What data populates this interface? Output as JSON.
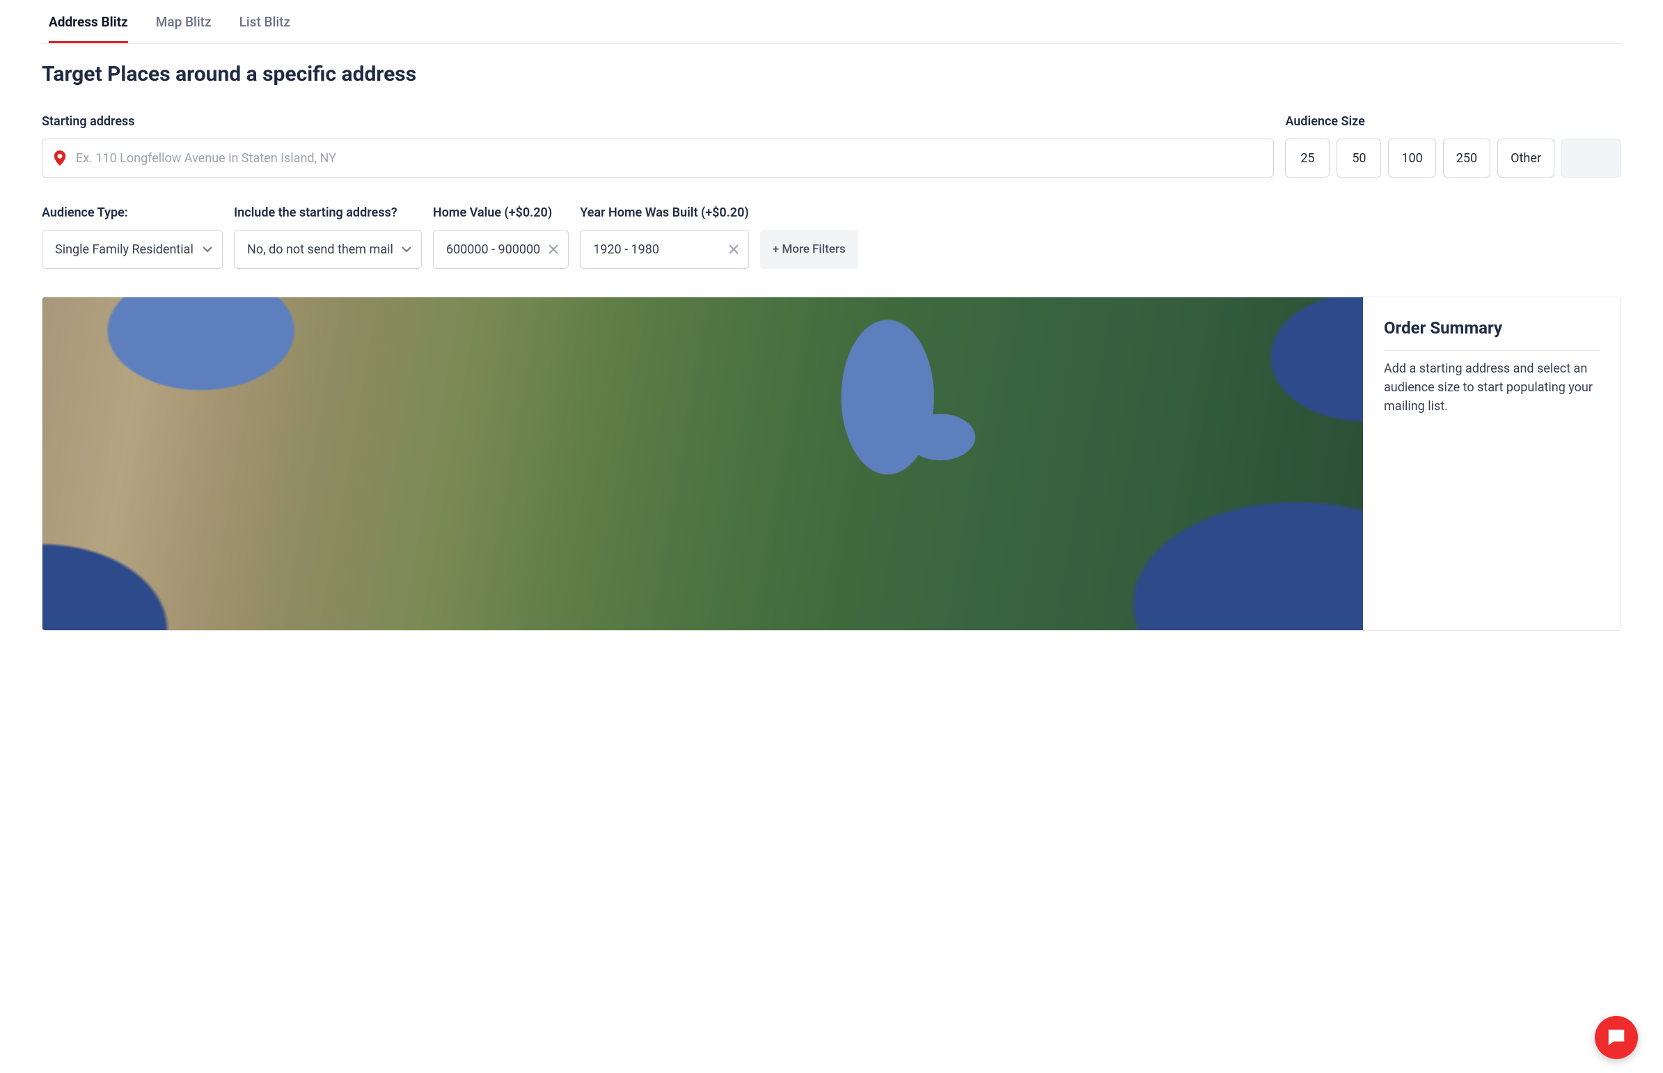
{
  "tabs": [
    {
      "label": "Address Blitz",
      "active": true
    },
    {
      "label": "Map Blitz",
      "active": false
    },
    {
      "label": "List Blitz",
      "active": false
    }
  ],
  "page_title": "Target Places around a specific address",
  "starting_address": {
    "label": "Starting address",
    "placeholder": "Ex. 110 Longfellow Avenue in Staten Island, NY",
    "value": ""
  },
  "audience_size": {
    "label": "Audience Size",
    "options": [
      "25",
      "50",
      "100",
      "250",
      "Other"
    ]
  },
  "audience_type": {
    "label": "Audience Type:",
    "value": "Single Family Residential"
  },
  "include_starting": {
    "label": "Include the starting address?",
    "value": "No, do not send them mail"
  },
  "home_value": {
    "label": "Home Value (+$0.20)",
    "value": "600000 - 900000"
  },
  "year_built": {
    "label": "Year Home Was Built (+$0.20)",
    "value": "1920 - 1980"
  },
  "more_filters_label": "+ More Filters",
  "order_summary": {
    "title": "Order Summary",
    "body": "Add a starting address and select an audience size to start populating your mailing list."
  }
}
